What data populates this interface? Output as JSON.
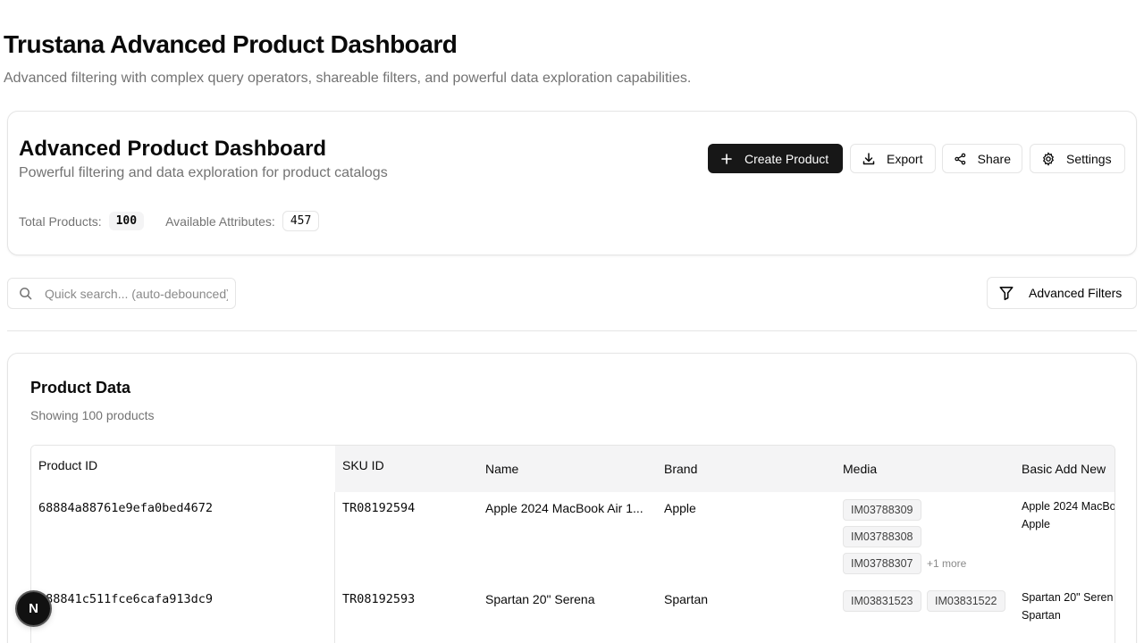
{
  "page": {
    "title": "Trustana Advanced Product Dashboard",
    "subtitle": "Advanced filtering with complex query operators, shareable filters, and powerful data exploration capabilities."
  },
  "header_card": {
    "title": "Advanced Product Dashboard",
    "subtitle": "Powerful filtering and data exploration for product catalogs",
    "buttons": {
      "create": "Create Product",
      "export": "Export",
      "share": "Share",
      "settings": "Settings"
    },
    "stats": {
      "total_label": "Total Products:",
      "total_value": "100",
      "attributes_label": "Available Attributes:",
      "attributes_value": "457"
    }
  },
  "search": {
    "placeholder": "Quick search... (auto-debounced)",
    "value": ""
  },
  "filters_button": "Advanced Filters",
  "product_data": {
    "title": "Product Data",
    "subtitle": "Showing 100 products",
    "columns": [
      "Product ID",
      "SKU ID",
      "Name",
      "Brand",
      "Media",
      "Basic Add New"
    ],
    "rows": [
      {
        "product_id": "68884a88761e9efa0bed4672",
        "sku": "TR08192594",
        "name": "Apple 2024 MacBook Air 1...",
        "brand": "Apple",
        "media": [
          "IM03788309",
          "IM03788308",
          "IM03788307"
        ],
        "media_more": "+1 more",
        "attr_lines": [
          "Apple 2024 MacBo",
          "Apple"
        ]
      },
      {
        "product_id": "688841c511fce6cafa913dc9",
        "sku": "TR08192593",
        "name": "Spartan 20\" Serena",
        "brand": "Spartan",
        "media": [
          "IM03831523",
          "IM03831522"
        ],
        "media_more": "",
        "attr_lines": [
          "Spartan 20\" Seren",
          "Spartan"
        ]
      }
    ]
  },
  "floating_badge": "N"
}
